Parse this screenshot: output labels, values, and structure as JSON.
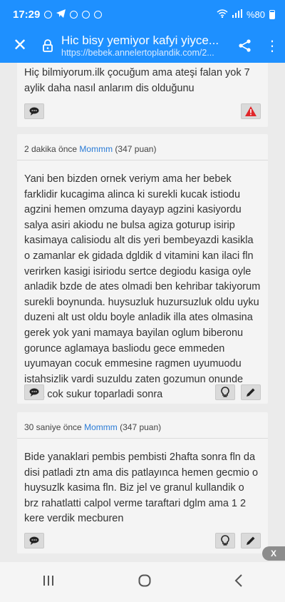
{
  "statusbar": {
    "time": "17:29",
    "battery": "%80"
  },
  "appbar": {
    "title": "Hic bisy yemiyor kafyi yiyce...",
    "url": "https://bebek.annelertoplandik.com/2..."
  },
  "posts": [
    {
      "meta": "",
      "user": "",
      "points": "",
      "text": "Hiç bilmiyorum.ilk çocuğum ama ateşi falan yok 7 aylik daha nasıl anlarım dis olduğunu"
    },
    {
      "meta": "2 dakika önce",
      "user": "Mommm",
      "points": "(347 puan)",
      "text": "Yani ben bizden ornek veriym ama her bebek farklidir kucagima alinca ki surekli kucak istiodu agzini hemen omzuma dayayp agzini kasiyordu salya asiri akiodu ne bulsa agiza goturup isirip kasimaya calisiodu alt dis yeri bembeyazdi kasikla o zamanlar ek gidada dgldik d vitamini kan ilaci fln verirken kasigi isiriodu sertce degiodu kasiga oyle anladik bzde de ates olmadi ben kehribar takiyorum surekli boynunda. huysuzluk huzursuzluk oldu uyku duzeni alt ust oldu boyle anladik illa ates olmasina gerek yok yani mamaya bayilan oglum biberonu gorunce aglamaya basliodu gece emmeden uyumayan cocuk emmesine ragmen uyumuodu istahsizlik vardi suzuldu zaten gozumun onunde ama cok sukur toparladi sonra"
    },
    {
      "meta": "30 saniye önce",
      "user": "Mommm",
      "points": "(347 puan)",
      "text": "Bide yanaklari pembis pembisti 2hafta sonra fln da disi patladi ztn ama dis patlayınca hemen gecmio o huysuzlk kasima fln. Biz jel ve granul kullandik o brz rahatlatti calpol verme taraftari dglm ama 1 2 kere verdik mecburen"
    }
  ],
  "float_close": "X",
  "icons": {
    "reply": "speech-bubble-icon",
    "report": "warning-icon",
    "idea": "lightbulb-icon",
    "edit": "pencil-icon"
  },
  "colors": {
    "accent": "#1e90ff",
    "warning": "#e0262a"
  }
}
